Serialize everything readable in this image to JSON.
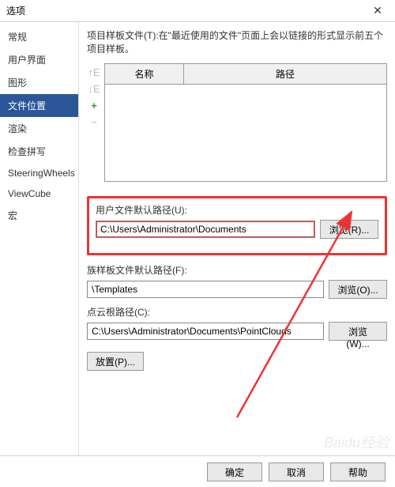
{
  "titlebar": {
    "title": "选项"
  },
  "sidebar": {
    "items": [
      {
        "label": "常规"
      },
      {
        "label": "用户界面"
      },
      {
        "label": "图形"
      },
      {
        "label": "文件位置"
      },
      {
        "label": "渲染"
      },
      {
        "label": "检查拼写"
      },
      {
        "label": "SteeringWheels"
      },
      {
        "label": "ViewCube"
      },
      {
        "label": "宏"
      }
    ],
    "selected_index": 3
  },
  "content": {
    "description": "项目样板文件(T):在\"最近使用的文件\"页面上会以链接的形式显示前五个项目样板。",
    "table": {
      "col_name": "名称",
      "col_path": "路径"
    },
    "user_files": {
      "label": "用户文件默认路径(U):",
      "value": "C:\\Users\\Administrator\\Documents",
      "browse": "浏览(R)..."
    },
    "family_template": {
      "label": "族样板文件默认路径(F):",
      "value": "\\Templates",
      "browse": "浏览(O)..."
    },
    "point_cloud": {
      "label": "点云根路径(C):",
      "value": "C:\\Users\\Administrator\\Documents\\PointClouds",
      "browse": "浏览(W)..."
    },
    "place_button": "放置(P)..."
  },
  "footer": {
    "ok": "确定",
    "cancel": "取消",
    "help": "帮助"
  },
  "watermark": "Baidu经验"
}
